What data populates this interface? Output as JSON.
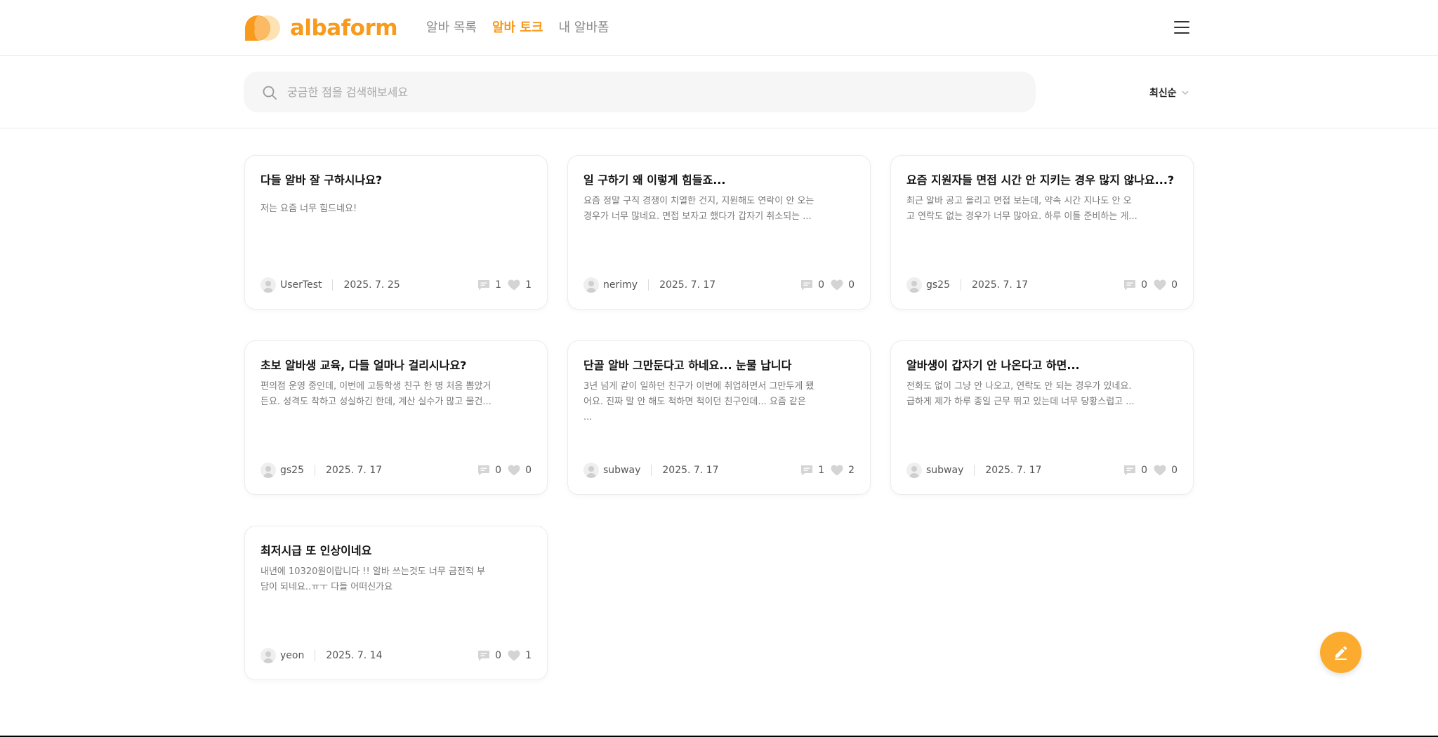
{
  "header": {
    "logo_text": "albaform",
    "nav": [
      {
        "label": "알바 목록",
        "active": false
      },
      {
        "label": "알바 토크",
        "active": true
      },
      {
        "label": "내 알바폼",
        "active": false
      }
    ]
  },
  "search": {
    "placeholder": "궁금한 점을 검색해보세요",
    "value": "",
    "sort_label": "최신순"
  },
  "posts": [
    {
      "title": "다들 알바 잘 구하시나요?",
      "body": "저는 요즘 너무 힘드네요!",
      "author": "UserTest",
      "date": "2025. 7. 25",
      "comments": "1",
      "likes": "1"
    },
    {
      "title": "일 구하기 왜 이렇게 힘들죠...",
      "body": "요즘 정말 구직 경쟁이 치열한 건지, 지원해도 연락이 안 오는 경우가 너무 많네요. 면접 보자고 했다가 갑자기 취소되는 ...",
      "author": "nerimy",
      "date": "2025. 7. 17",
      "comments": "0",
      "likes": "0"
    },
    {
      "title": "요즘 지원자들 면접 시간 안 지키는 경우 많지 않나요...?",
      "body": "최근 알바 공고 올리고 면접 보는데, 약속 시간 지나도 안 오고 연락도 없는 경우가 너무 많아요. 하루 이틀 준비하는 게...",
      "author": "gs25",
      "date": "2025. 7. 17",
      "comments": "0",
      "likes": "0"
    },
    {
      "title": "초보 알바생 교육, 다들 얼마나 걸리시나요?",
      "body": "편의점 운영 중인데, 이번에 고등학생 친구 한 명 처음 뽑았거든요. 성격도 착하고 성실하긴 한데, 계산 실수가 많고 물건...",
      "author": "gs25",
      "date": "2025. 7. 17",
      "comments": "0",
      "likes": "0"
    },
    {
      "title": "단골 알바 그만둔다고 하네요... 눈물 납니다",
      "body": "3년 넘게 같이 일하던 친구가 이번에 취업하면서 그만두게 됐어요. 진짜 말 안 해도 척하면 척이던 친구인데... 요즘 같은 ...",
      "author": "subway",
      "date": "2025. 7. 17",
      "comments": "1",
      "likes": "2"
    },
    {
      "title": "알바생이 갑자기 안 나온다고 하면...",
      "body": "전화도 없이 그냥 안 나오고, 연락도 안 되는 경우가 있네요. 급하게 제가 하루 종일 근무 뛰고 있는데 너무 당황스럽고 ...",
      "author": "subway",
      "date": "2025. 7. 17",
      "comments": "0",
      "likes": "0"
    },
    {
      "title": "최저시급 또 인상이네요",
      "body": "내년에 10320원이랍니다 !! 알바 쓰는것도 너무 금전적 부담이 되네요..ㅠㅜ 다들 어떠신가요",
      "author": "yeon",
      "date": "2025. 7. 14",
      "comments": "0",
      "likes": "1"
    }
  ],
  "icons": {
    "logo": "albaform-logo-icon",
    "menu": "hamburger-menu-icon",
    "search": "search-icon",
    "sort": "chevron-down-icon",
    "avatar": "user-avatar-icon",
    "comment": "comment-icon",
    "like": "heart-icon",
    "fab": "pencil-icon"
  },
  "colors": {
    "brand": "#f89a1c",
    "fab": "#fbac2e",
    "text_primary": "#111111",
    "text_muted": "#7a7a7a"
  }
}
